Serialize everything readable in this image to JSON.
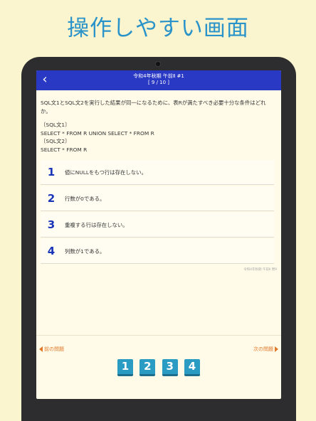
{
  "headline": "操作しやすい画面",
  "navbar": {
    "back_icon": "chevron-left-icon",
    "title": "令和4年秋期 午前Ⅱ #1",
    "progress": "[ 9 / 10 ]"
  },
  "question": {
    "text": "SQL文1とSQL文2を実行した結果が同一になるために、表Rが満たすべき必要十分な条件はどれか。",
    "sql1_label": "〔SQL文1〕",
    "sql1": "SELECT * FROM R UNION SELECT * FROM R",
    "sql2_label": "〔SQL文2〕",
    "sql2": "SELECT * FROM R"
  },
  "choices": [
    {
      "number": "1",
      "text": "値にNULLをもつ行は存在しない。"
    },
    {
      "number": "2",
      "text": "行数が0である。"
    },
    {
      "number": "3",
      "text": "重複する行は存在しない。"
    },
    {
      "number": "4",
      "text": "列数が1である。"
    }
  ],
  "source": "令和4年秋期 午前Ⅱ 問9",
  "footer": {
    "prev_label": "前の問題",
    "next_label": "次の問題"
  },
  "answer_buttons": [
    "1",
    "2",
    "3",
    "4"
  ],
  "colors": {
    "background": "#faf5cf",
    "headline": "#2a93c9",
    "navbar": "#2a39c4",
    "choice_number": "#1a35b8",
    "link": "#e0782a",
    "answer_button": "#2a9bc2"
  }
}
